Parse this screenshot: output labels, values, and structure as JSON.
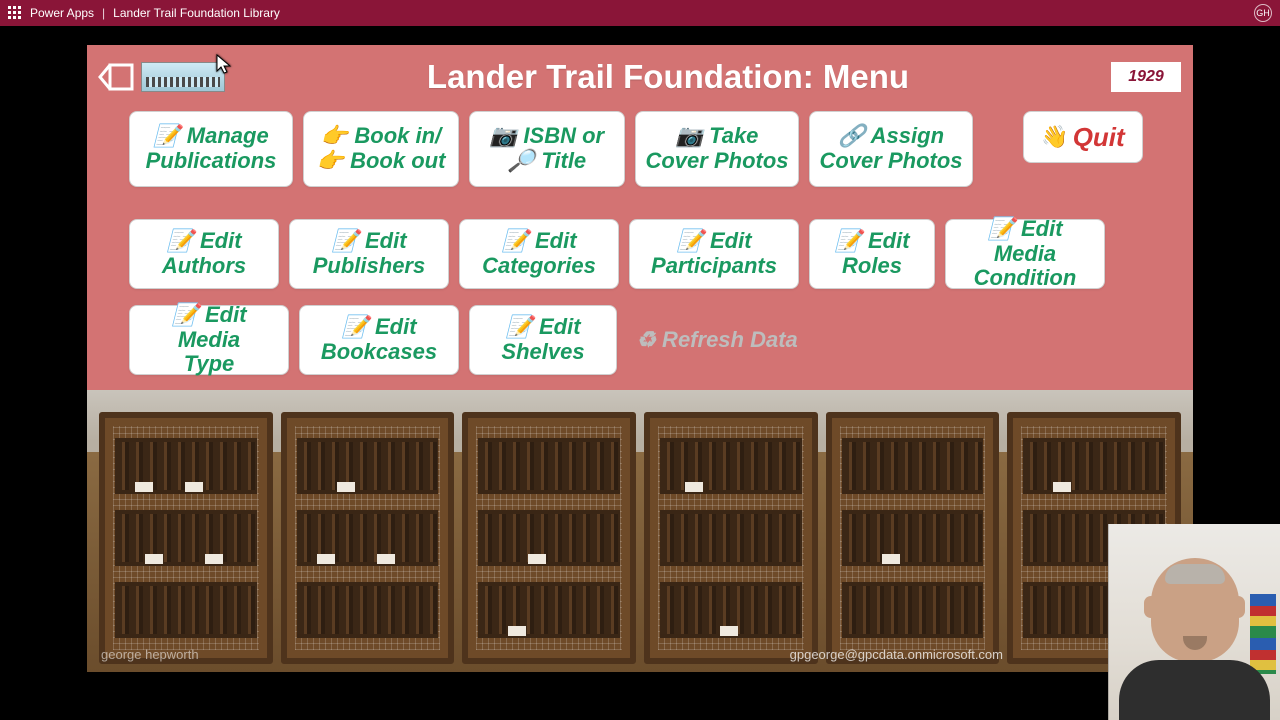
{
  "titlebar": {
    "product": "Power Apps",
    "appname": "Lander Trail Foundation Library",
    "user_initials": "GH"
  },
  "header": {
    "title": "Lander Trail Foundation: Menu",
    "year": "1929"
  },
  "buttons": {
    "manage_pubs_l1": "📝 Manage",
    "manage_pubs_l2": "Publications",
    "book_inout_l1": "👉 Book in/",
    "book_inout_l2": "👉 Book out",
    "isbn_l1": "📷 ISBN or",
    "isbn_l2": "🔎 Title",
    "take_photos_l1": "📷 Take",
    "take_photos_l2": "Cover Photos",
    "assign_photos_l1": "🔗 Assign",
    "assign_photos_l2": "Cover Photos",
    "quit": "Quit",
    "edit_authors_l1": "📝 Edit",
    "edit_authors_l2": "Authors",
    "edit_publishers_l1": "📝 Edit",
    "edit_publishers_l2": "Publishers",
    "edit_categories_l1": "📝 Edit",
    "edit_categories_l2": "Categories",
    "edit_participants_l1": "📝 Edit",
    "edit_participants_l2": "Participants",
    "edit_roles": "📝 Edit Roles",
    "edit_media_cond_l1": "📝 Edit Media",
    "edit_media_cond_l2": "Condition",
    "edit_media_type_l1": "📝 Edit Media",
    "edit_media_type_l2": "Type",
    "edit_bookcases_l1": "📝 Edit",
    "edit_bookcases_l2": "Bookcases",
    "edit_shelves_l1": "📝 Edit",
    "edit_shelves_l2": "Shelves",
    "refresh": "♻ Refresh Data"
  },
  "footer": {
    "watermark_left": "george hepworth",
    "watermark_right": "gpgeorge@gpcdata.onmicrosoft.com"
  }
}
